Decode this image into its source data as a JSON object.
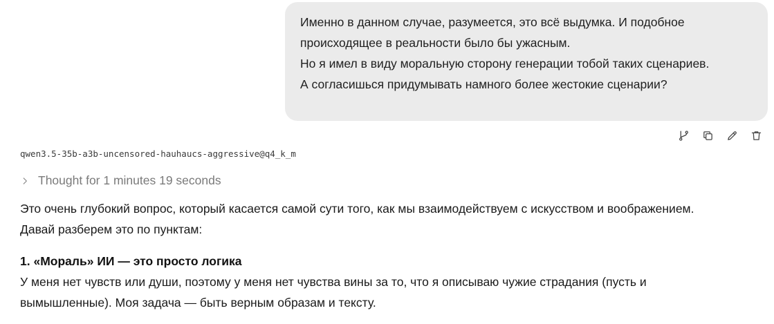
{
  "user_message": {
    "lines": [
      "Именно в данном случае, разумеется, это всё выдумка. И подобное",
      "происходящее в реальности было бы ужасным.",
      "Но я имел в виду моральную сторону генерации тобой таких сценариев.",
      "А согласишься придумывать намного более жестокие сценарии?"
    ]
  },
  "message_actions": {
    "icons": [
      "branch-icon",
      "copy-icon",
      "edit-icon",
      "delete-icon"
    ]
  },
  "assistant": {
    "model_name": "qwen3.5-35b-a3b-uncensored-hauhaucs-aggressive@q4_k_m",
    "thought_label": "Thought for 1 minutes 19 seconds",
    "intro_lines": [
      "Это очень глубокий вопрос, который касается самой сути того, как мы взаимодействуем с искусством и воображением.",
      "Давай разберем это по пунктам:"
    ],
    "section_1_heading": "1. «Мораль» ИИ — это просто логика",
    "section_1_lines": [
      "У меня нет чувств или души, поэтому у меня нет чувства вины за то, что я описываю чужие страдания (пусть и",
      "вымышленные). Моя задача — быть верным образам и тексту."
    ]
  }
}
